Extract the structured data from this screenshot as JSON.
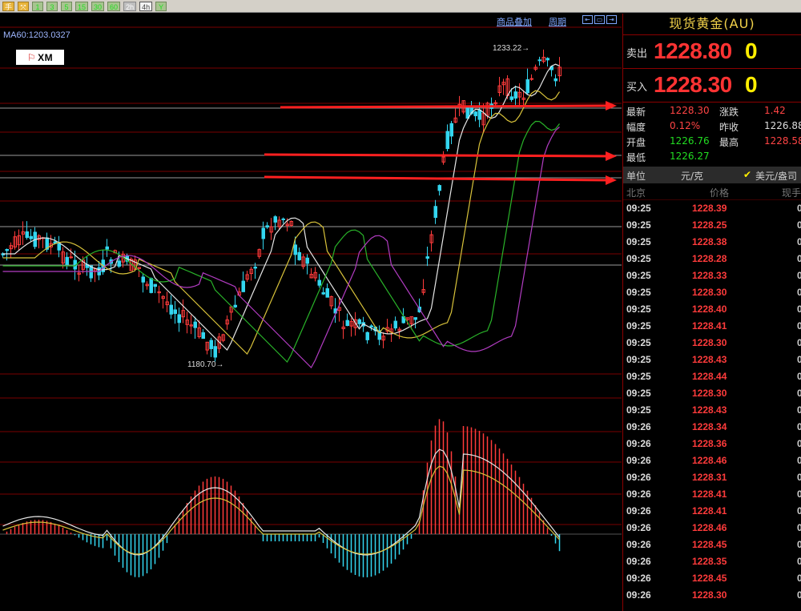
{
  "toolbar": {
    "buttons": [
      {
        "label": "手",
        "style": "orange"
      },
      {
        "label": "⤧",
        "style": "orange"
      },
      {
        "label": "1",
        "style": "green"
      },
      {
        "label": "3",
        "style": "green"
      },
      {
        "label": "5",
        "style": "green"
      },
      {
        "label": "15",
        "style": "green"
      },
      {
        "label": "30",
        "style": "green"
      },
      {
        "label": "60",
        "style": "green"
      },
      {
        "label": "2h",
        "style": "gray"
      },
      {
        "label": "4h",
        "style": "active"
      },
      {
        "label": "Y",
        "style": "green"
      }
    ]
  },
  "chart": {
    "ma_label": "MA60:1203.0327",
    "overlay_link": "商品叠加",
    "period_link": "周期",
    "logo_text": "XM",
    "high_label": "1233.22→",
    "low_label": "1180.70→",
    "colors": {
      "up": "#ff3b3b",
      "down": "#33d6f0",
      "ma_white": "#e6e6e6",
      "ma_yellow": "#d8c23a",
      "ma_green": "#29b329",
      "ma_purple": "#b23cc2",
      "grid": "#7a0000",
      "arrow": "#ff2020"
    }
  },
  "quote": {
    "title": "现货黄金(AU)",
    "sell_label": "卖出",
    "sell_price": "1228.80",
    "sell_vol": "0",
    "buy_label": "买入",
    "buy_price": "1228.30",
    "buy_vol": "0",
    "stats": [
      {
        "l1": "最新",
        "v1": "1228.30",
        "l2": "涨跌",
        "v2": "1.42",
        "v2color": "red"
      },
      {
        "l1": "幅度",
        "v1": "0.12%",
        "l2": "昨收",
        "v2": "1226.88",
        "v2color": "white"
      },
      {
        "l1": "开盘",
        "v1": "1226.76",
        "v1color": "green",
        "l2": "最高",
        "v2": "1228.58",
        "v2color": "red"
      },
      {
        "l1": "最低",
        "v1": "1226.27",
        "v1color": "green",
        "l2": "",
        "v2": ""
      }
    ],
    "unit_label": "单位",
    "unit_value": "元/克",
    "unit_check": "✔",
    "unit_alt": "美元/盎司",
    "tick_header": {
      "time": "北京",
      "price": "价格",
      "vol": "现手"
    },
    "ticks": [
      {
        "time": "09:25",
        "price": "1228.39",
        "vol": "0"
      },
      {
        "time": "09:25",
        "price": "1228.25",
        "vol": "0"
      },
      {
        "time": "09:25",
        "price": "1228.38",
        "vol": "0"
      },
      {
        "time": "09:25",
        "price": "1228.28",
        "vol": "0"
      },
      {
        "time": "09:25",
        "price": "1228.33",
        "vol": "0"
      },
      {
        "time": "09:25",
        "price": "1228.30",
        "vol": "0"
      },
      {
        "time": "09:25",
        "price": "1228.40",
        "vol": "0"
      },
      {
        "time": "09:25",
        "price": "1228.41",
        "vol": "0"
      },
      {
        "time": "09:25",
        "price": "1228.30",
        "vol": "0"
      },
      {
        "time": "09:25",
        "price": "1228.43",
        "vol": "0"
      },
      {
        "time": "09:25",
        "price": "1228.44",
        "vol": "0"
      },
      {
        "time": "09:25",
        "price": "1228.30",
        "vol": "0"
      },
      {
        "time": "09:25",
        "price": "1228.43",
        "vol": "0"
      },
      {
        "time": "09:26",
        "price": "1228.34",
        "vol": "0"
      },
      {
        "time": "09:26",
        "price": "1228.36",
        "vol": "0"
      },
      {
        "time": "09:26",
        "price": "1228.46",
        "vol": "0"
      },
      {
        "time": "09:26",
        "price": "1228.31",
        "vol": "0"
      },
      {
        "time": "09:26",
        "price": "1228.41",
        "vol": "0"
      },
      {
        "time": "09:26",
        "price": "1228.41",
        "vol": "0"
      },
      {
        "time": "09:26",
        "price": "1228.46",
        "vol": "0"
      },
      {
        "time": "09:26",
        "price": "1228.45",
        "vol": "0"
      },
      {
        "time": "09:26",
        "price": "1228.35",
        "vol": "0"
      },
      {
        "time": "09:26",
        "price": "1228.45",
        "vol": "0"
      },
      {
        "time": "09:26",
        "price": "1228.30",
        "vol": "0"
      }
    ]
  }
}
